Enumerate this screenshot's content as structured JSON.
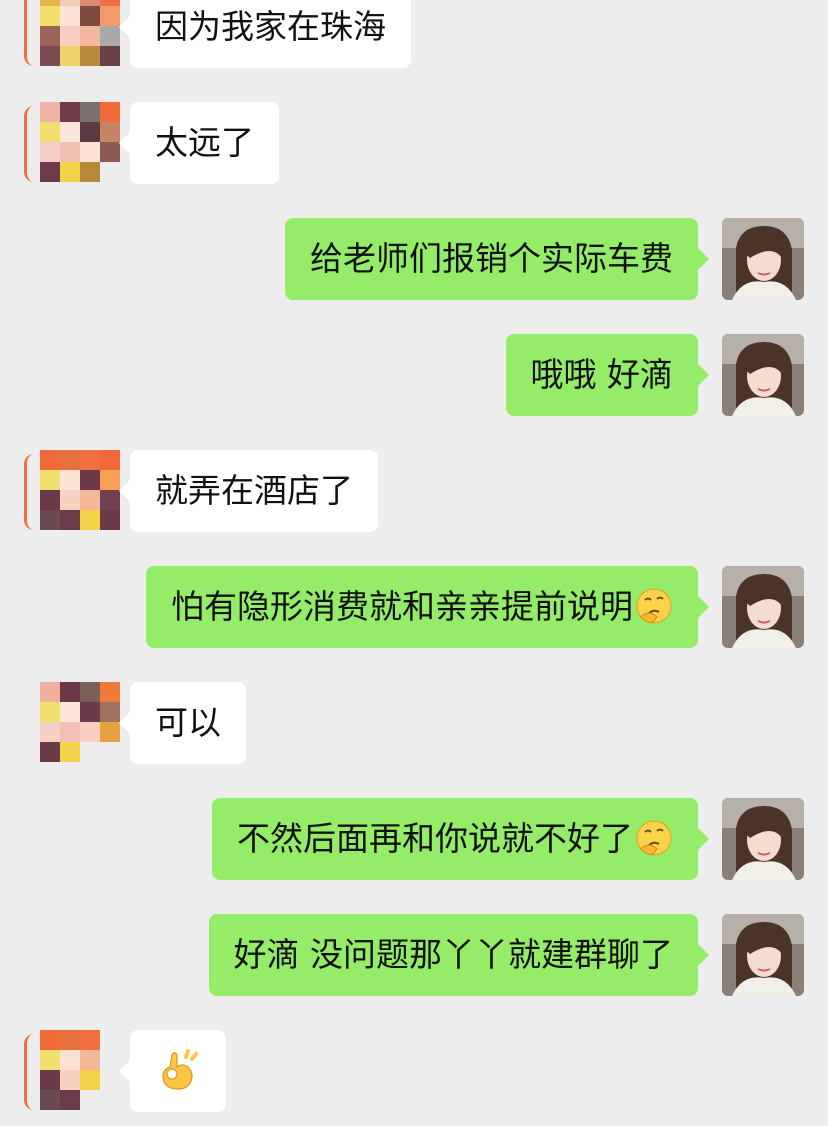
{
  "palette": {
    "background": "#ededed",
    "bubble_mine": "#95ec69",
    "bubble_other": "#ffffff",
    "text": "#111111"
  },
  "messages": [
    {
      "side": "other",
      "text": "因为我家在珠海",
      "emoji": ""
    },
    {
      "side": "other",
      "text": "太远了",
      "emoji": ""
    },
    {
      "side": "mine",
      "text": "给老师们报销个实际车费",
      "emoji": ""
    },
    {
      "side": "mine",
      "text": "哦哦 好滴",
      "emoji": ""
    },
    {
      "side": "other",
      "text": "就弄在酒店了",
      "emoji": ""
    },
    {
      "side": "mine",
      "text": "怕有隐形消费就和亲亲提前说明",
      "emoji": "thinking-face-emoji"
    },
    {
      "side": "other",
      "text": "可以",
      "emoji": ""
    },
    {
      "side": "mine",
      "text": "不然后面再和你说就不好了",
      "emoji": "thinking-face-emoji"
    },
    {
      "side": "mine",
      "text": "好滴 没问题那丫丫就建群聊了",
      "emoji": ""
    },
    {
      "side": "other",
      "text": "",
      "emoji": "ok-hand-emoji"
    }
  ]
}
